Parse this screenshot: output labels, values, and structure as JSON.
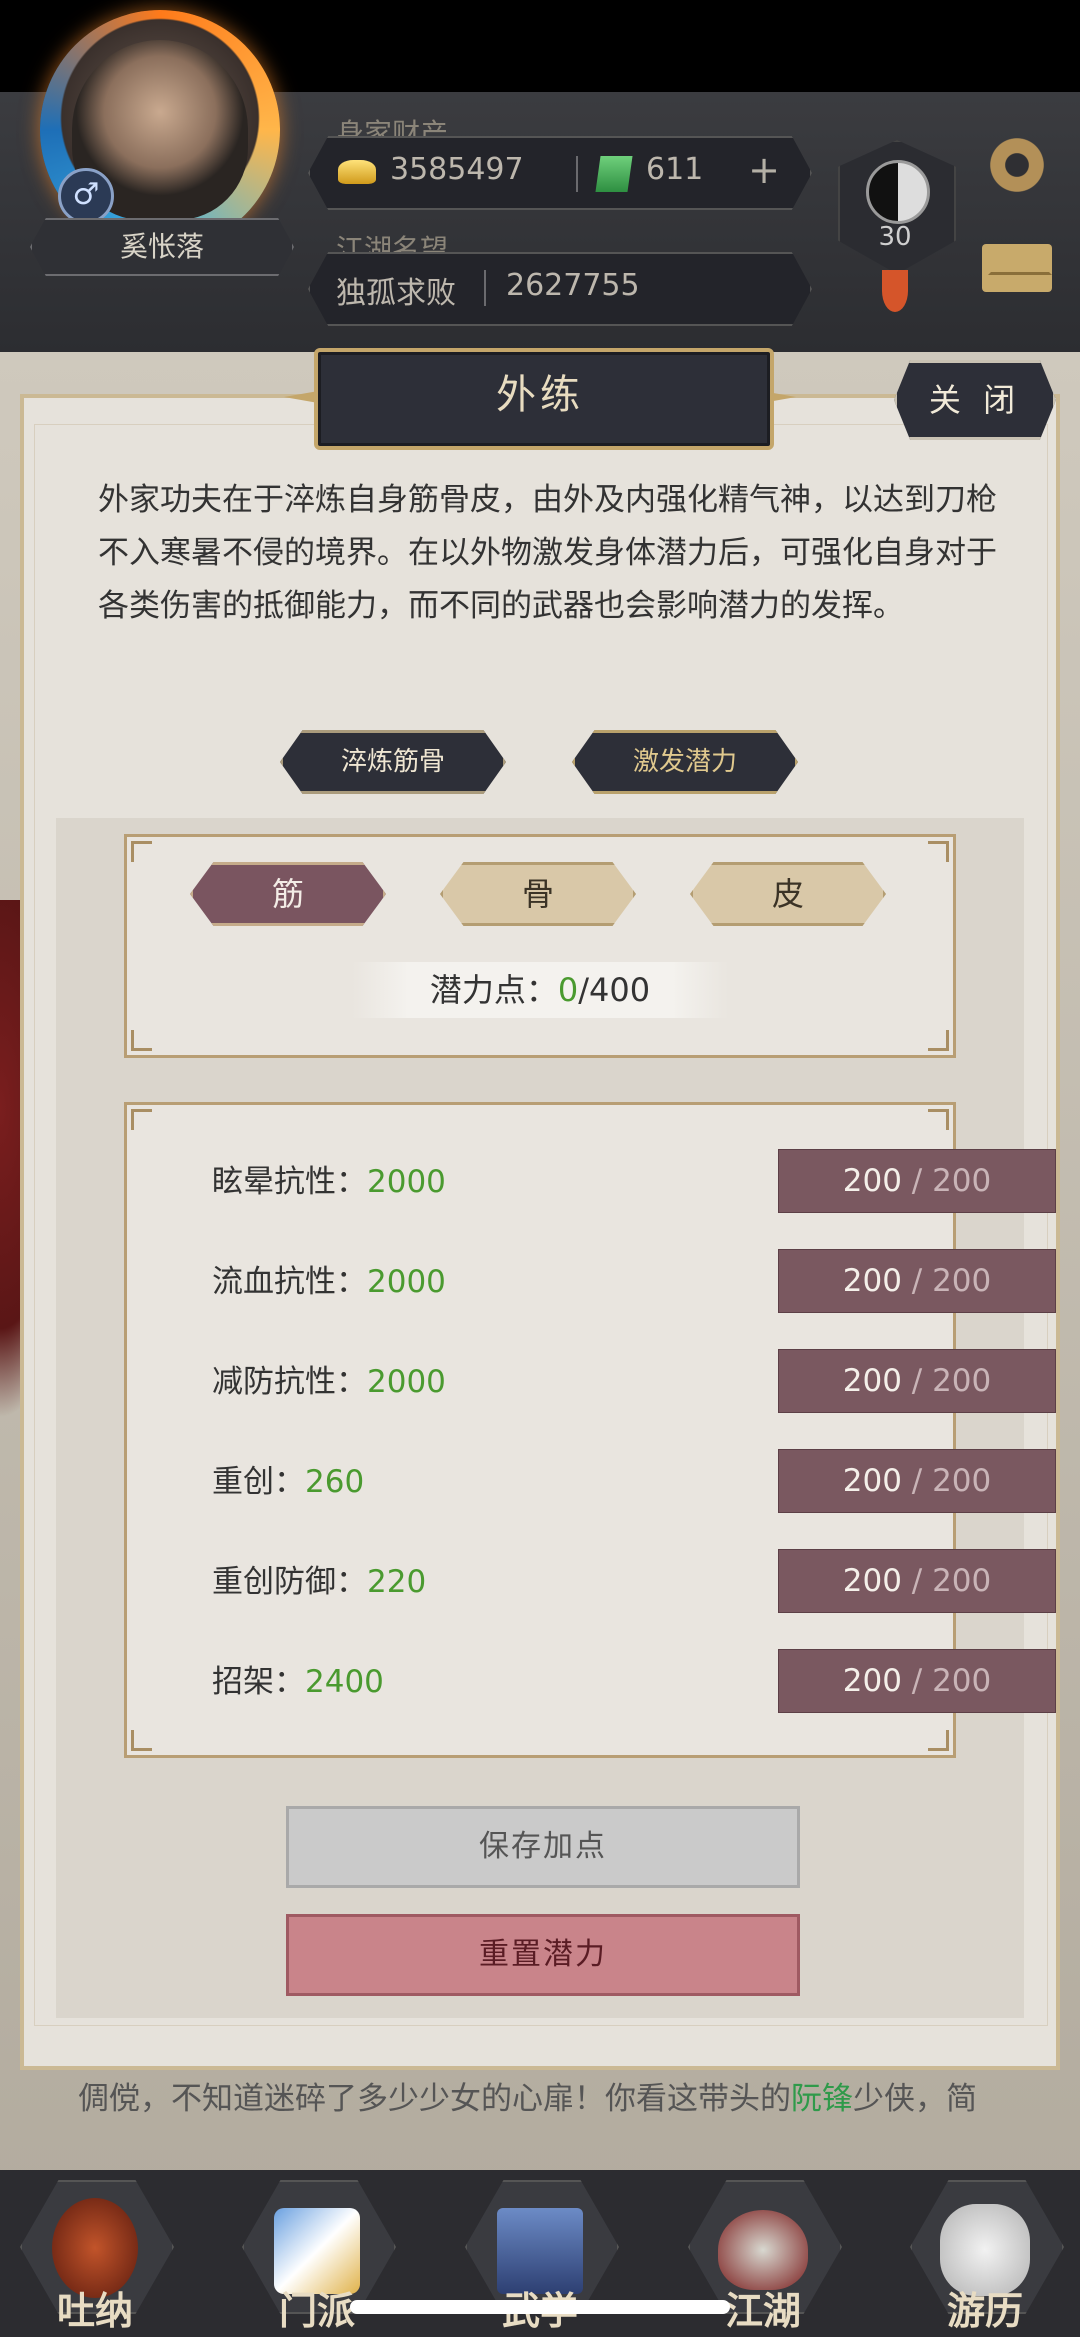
{
  "header": {
    "wealth_label": "身家财产",
    "gold": "3585497",
    "jade": "611",
    "fame_label": "江湖名望",
    "fame_title": "独孤求败",
    "fame_value": "2627755",
    "player_name": "奚怅落",
    "gender_symbol": "♂",
    "level": "30"
  },
  "panel": {
    "title": "外练",
    "close_label": "关 闭",
    "description": "外家功夫在于淬炼自身筋骨皮，由外及内强化精气神，以达到刀枪不入寒暑不侵的境界。在以外物激发身体潜力后，可强化自身对于各类伤害的抵御能力，而不同的武器也会影响潜力的发挥。",
    "mode_buttons": [
      "淬炼筋骨",
      "激发潜力"
    ],
    "tabs": [
      "筋",
      "骨",
      "皮"
    ],
    "potential_label": "潜力点：",
    "potential_current": "0",
    "potential_max": "/400",
    "stats": [
      {
        "label": "眩晕抗性：",
        "value": "2000",
        "cur": "200",
        "max": "200"
      },
      {
        "label": "流血抗性：",
        "value": "2000",
        "cur": "200",
        "max": "200"
      },
      {
        "label": "减防抗性：",
        "value": "2000",
        "cur": "200",
        "max": "200"
      },
      {
        "label": "重创：",
        "value": "260",
        "cur": "200",
        "max": "200"
      },
      {
        "label": "重创防御：",
        "value": "220",
        "cur": "200",
        "max": "200"
      },
      {
        "label": "招架：",
        "value": "2400",
        "cur": "200",
        "max": "200"
      }
    ],
    "bar_separator": " / ",
    "save_label": "保存加点",
    "reset_label": "重置潜力"
  },
  "story": {
    "line1_prefix": "倜傥，不知道迷碎了多少少女的心扉！你看这带头的",
    "line1_highlight": "阮锋",
    "line1_suffix": "少侠，简"
  },
  "nav": [
    "吐纳",
    "门派",
    "武学",
    "江湖",
    "游历"
  ],
  "colors": {
    "accent_gold": "#c4a66a",
    "stat_green": "#4a9a2f",
    "bar_fill": "#7a5860",
    "reset_red": "#c9848a"
  }
}
